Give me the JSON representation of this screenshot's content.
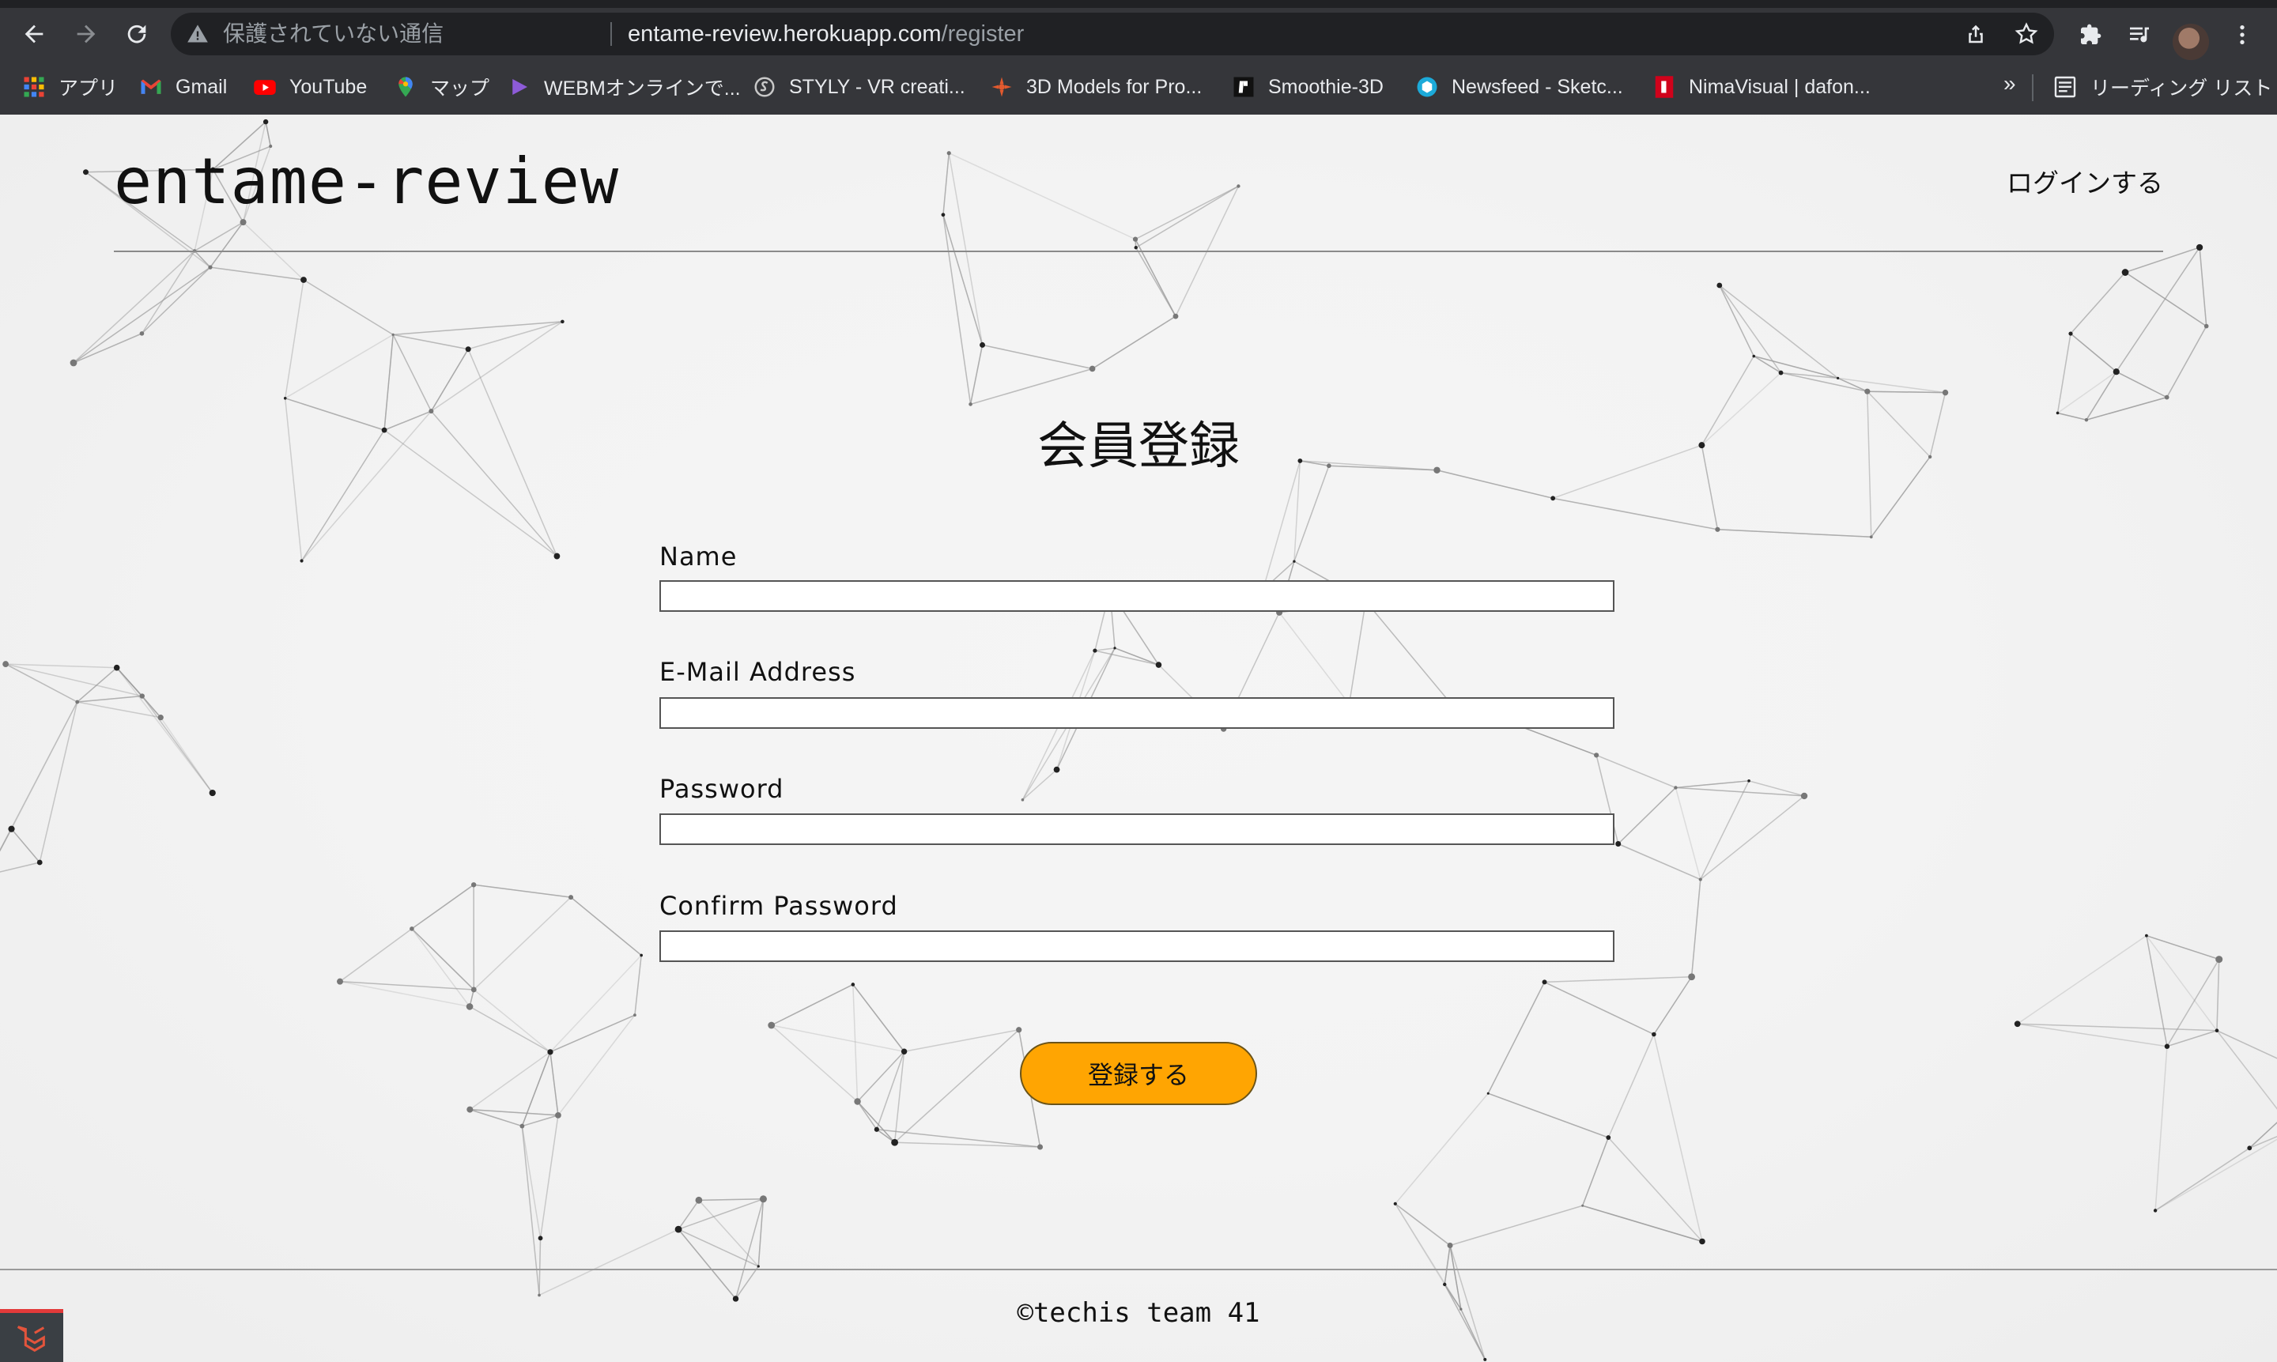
{
  "browser": {
    "insecure_label": "保護されていない通信",
    "url_host": "entame-review.herokuapp.com",
    "url_path": "/register",
    "icons": [
      "back-icon",
      "forward-icon",
      "reload-icon",
      "warning-icon",
      "share-icon",
      "star-icon",
      "extensions-icon",
      "media-icon",
      "profile-avatar",
      "menu-icon"
    ]
  },
  "bookmarks": {
    "items": [
      {
        "label": "アプリ",
        "icon": "apps-grid-icon"
      },
      {
        "label": "Gmail",
        "icon": "gmail-icon"
      },
      {
        "label": "YouTube",
        "icon": "youtube-icon"
      },
      {
        "label": "マップ",
        "icon": "maps-icon"
      },
      {
        "label": "WEBMオンラインで...",
        "icon": "play-icon"
      },
      {
        "label": "STYLY - VR creati...",
        "icon": "styly-icon"
      },
      {
        "label": "3D Models for Pro...",
        "icon": "3d-models-icon"
      },
      {
        "label": "Smoothie-3D",
        "icon": "smoothie-icon"
      },
      {
        "label": "Newsfeed - Sketc...",
        "icon": "sketchfab-icon"
      },
      {
        "label": "NimaVisual | dafon...",
        "icon": "dafont-icon"
      }
    ],
    "more": "»",
    "reading_list": "リーディング リスト"
  },
  "site": {
    "brand": "entame-review",
    "login_link": "ログインする"
  },
  "form": {
    "title": "会員登録",
    "fields": [
      {
        "label": "Name",
        "value": "",
        "type": "text"
      },
      {
        "label": "E-Mail Address",
        "value": "",
        "type": "email"
      },
      {
        "label": "Password",
        "value": "",
        "type": "password"
      },
      {
        "label": "Confirm Password",
        "value": "",
        "type": "password"
      }
    ],
    "submit_label": "登録する"
  },
  "footer": {
    "copyright": "©techis team 41"
  },
  "colors": {
    "accent": "#ffa502",
    "chrome_dark": "#35363a",
    "omnibox": "#202124"
  }
}
